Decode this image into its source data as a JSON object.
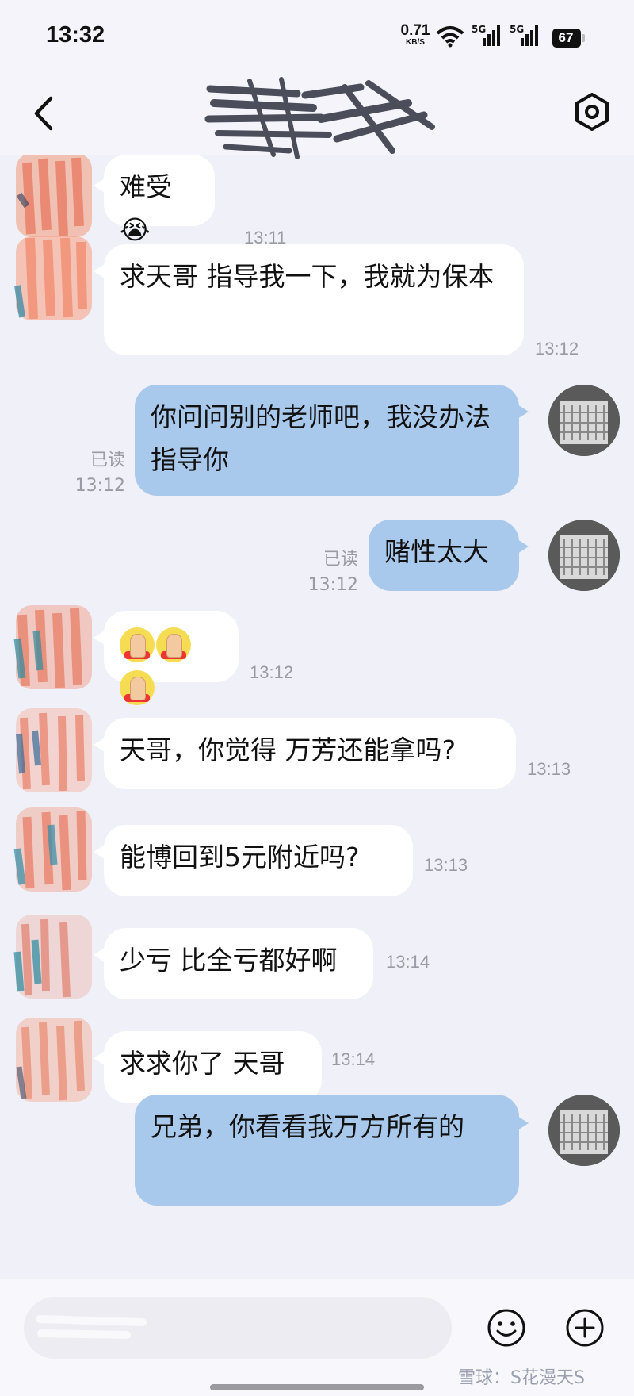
{
  "status_bar": {
    "time": "13:32",
    "net_speed": "0.71",
    "net_speed_unit": "KB/S",
    "signal1_label": "5G",
    "signal2_label": "5G",
    "battery": "67"
  },
  "header": {
    "title": "",
    "back_icon": "chevron-left-icon",
    "settings_icon": "settings-gear-icon"
  },
  "messages": [
    {
      "side": "in",
      "text": "难受😭",
      "time": "13:11"
    },
    {
      "side": "in",
      "text": "求天哥 指导我一下，我就为保本",
      "time": "13:12"
    },
    {
      "side": "out",
      "text": "你问问别的老师吧，我没办法指导你",
      "read": "已读",
      "time": "13:12"
    },
    {
      "side": "out",
      "text": "赌性太大",
      "read": "已读",
      "time": "13:12"
    },
    {
      "side": "in",
      "emoji": "🙏🙏🙏",
      "time": "13:12"
    },
    {
      "side": "in",
      "text": "天哥，你觉得 万芳还能拿吗?",
      "time": "13:13"
    },
    {
      "side": "in",
      "text": "能博回到5元附近吗?",
      "time": "13:13"
    },
    {
      "side": "in",
      "text": "少亏 比全亏都好啊",
      "time": "13:14"
    },
    {
      "side": "in",
      "text": "求求你了 天哥",
      "time": "13:14"
    },
    {
      "side": "out",
      "text": "兄弟，你看看我万方所有的",
      "time": ""
    }
  ],
  "input_bar": {
    "placeholder": "",
    "emoji_icon": "smiley-icon",
    "plus_icon": "plus-circle-icon",
    "watermark": "雪球：S花漫天S"
  },
  "colors": {
    "background": "#f0f0f8",
    "incoming_bubble": "#ffffff",
    "outgoing_bubble": "#a9c9ec",
    "timestamp": "#9a9aa4"
  }
}
